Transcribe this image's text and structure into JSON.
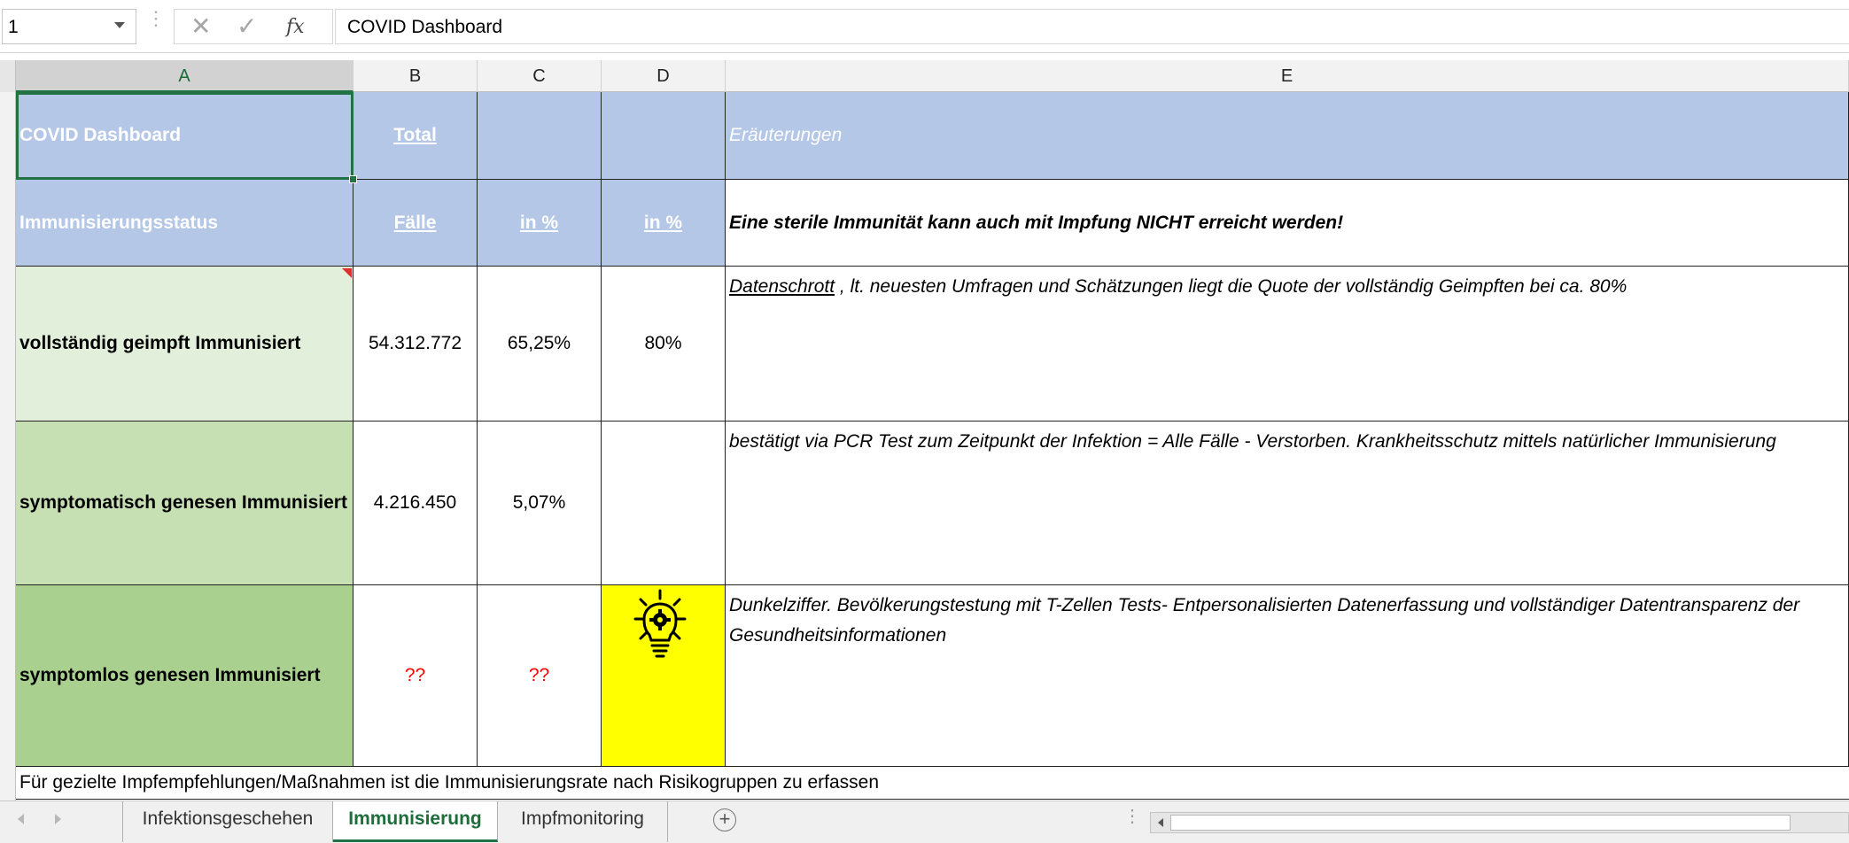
{
  "formula_bar": {
    "name_box": "1",
    "cancel_icon": "✕",
    "enter_icon": "✓",
    "fx_label": "fx",
    "content": "COVID Dashboard"
  },
  "columns": [
    "A",
    "B",
    "C",
    "D",
    "E"
  ],
  "sheet": {
    "header": {
      "title": "COVID Dashboard",
      "total": "Total",
      "explanations": "Eräuterungen"
    },
    "subheader": {
      "status": "Immunisierungsstatus",
      "cases": "Fälle ",
      "pct_c": "in %",
      "pct_d": "in %",
      "note": "Eine sterile Immunität kann auch mit Impfung NICHT erreicht werden!"
    },
    "rows": [
      {
        "label": "vollständig geimpft Immunisiert",
        "cases": "54.312.772",
        "pct": "65,25%",
        "pct_d": "80%",
        "note_link": "Datenschrott",
        "note": " , lt. neuesten Umfragen und Schätzungen liegt die Quote der vollständig Geimpften bei ca. 80%"
      },
      {
        "label": "symptomatisch genesen Immunisiert",
        "cases": "4.216.450",
        "pct": "5,07%",
        "pct_d": "",
        "note": "bestätigt via PCR Test zum Zeitpunkt der Infektion = Alle Fälle - Verstorben. Krankheitsschutz mittels natürlicher Immunisierung"
      },
      {
        "label": "symptomlos genesen Immunisiert",
        "cases": "??",
        "pct": "??",
        "icon": "lightbulb-gear-icon",
        "note": "Dunkelziffer. Bevölkerungstestung mit T-Zellen Tests- Entpersonalisierten Datenerfassung und vollständiger Datentransparenz der Gesundheitsinformationen"
      }
    ],
    "footer_note": "Für gezielte Impfempfehlungen/Maßnahmen ist die Immunisierungsrate nach Risikogruppen zu erfassen"
  },
  "tabs": [
    {
      "label": "Infektionsgeschehen",
      "active": false
    },
    {
      "label": "Immunisierung",
      "active": true
    },
    {
      "label": "Impfmonitoring",
      "active": false
    }
  ],
  "add_sheet": "+",
  "colors": {
    "header_blue": "#b4c7e7",
    "green_light": "#e2efda",
    "green_mid": "#c6e0b4",
    "green_dark": "#a9d08e",
    "highlight_yellow": "#ffff00",
    "excel_green": "#217346",
    "question_red": "#ff0000"
  }
}
